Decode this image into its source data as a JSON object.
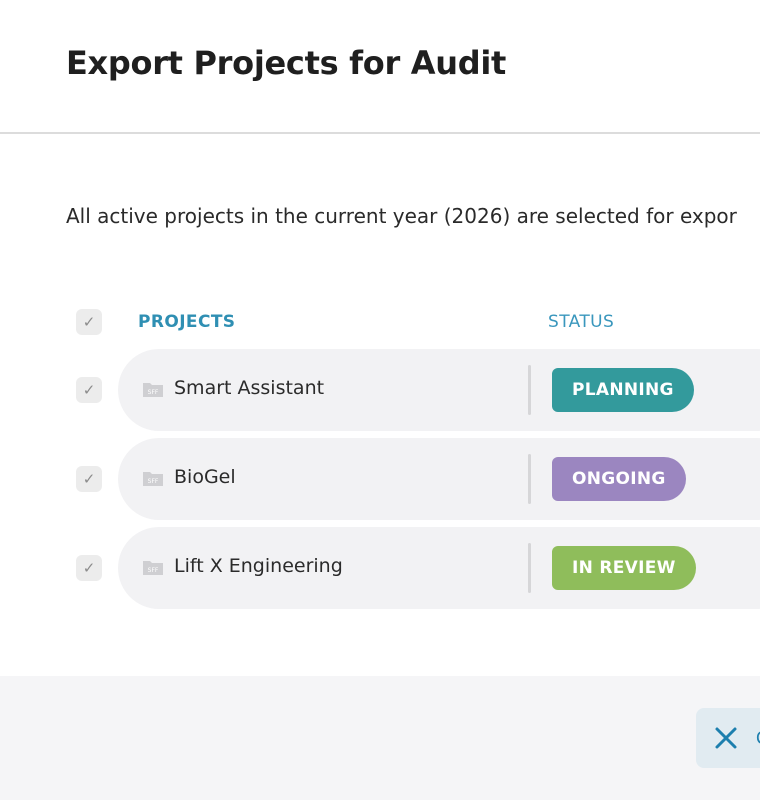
{
  "dialog": {
    "title": "Export Projects for Audit",
    "description": "All active projects in the current year (2026) are selected for expor"
  },
  "table": {
    "header_checkbox": "✓",
    "columns": {
      "projects": "PROJECTS",
      "status": "STATUS"
    },
    "rows": [
      {
        "checkbox": "✓",
        "icon": "file-icon",
        "name": "Smart Assistant",
        "status": "PLANNING",
        "status_color": "#339a9c"
      },
      {
        "checkbox": "✓",
        "icon": "file-icon",
        "name": "BioGel",
        "status": "ONGOING",
        "status_color": "#9b86c0"
      },
      {
        "checkbox": "✓",
        "icon": "file-icon",
        "name": "Lift X Engineering",
        "status": "IN REVIEW",
        "status_color": "#8fbd5b"
      }
    ]
  },
  "footer": {
    "cancel_icon": "close-icon",
    "cancel_label": "C"
  },
  "colors": {
    "accent": "#2f8fb3",
    "row_background": "#f2f2f4"
  }
}
